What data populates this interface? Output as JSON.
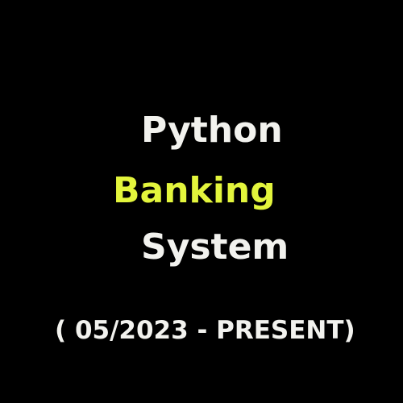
{
  "title": {
    "line1": "Python",
    "line2": "Banking",
    "line3": "System"
  },
  "period": "( 05/2023 -  PRESENT)",
  "colors": {
    "background": "#000000",
    "text": "#f2f2ee",
    "accent": "#e3f53c"
  }
}
